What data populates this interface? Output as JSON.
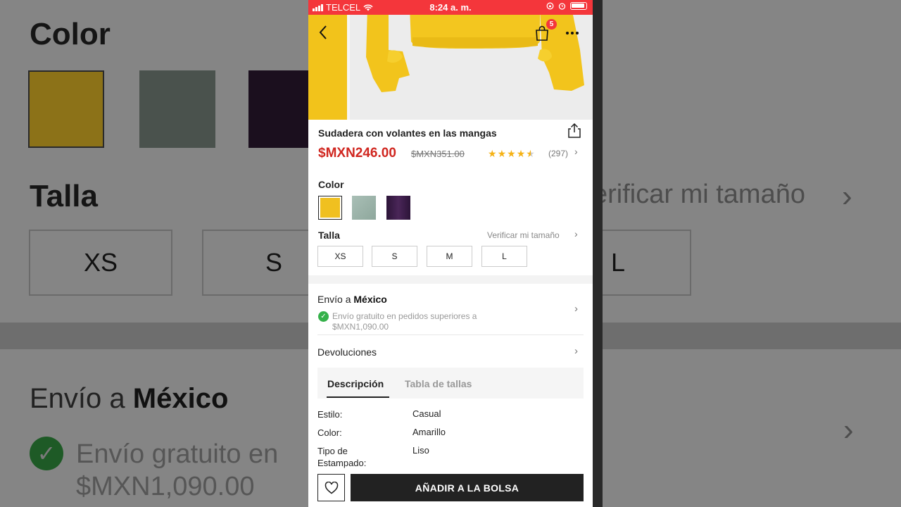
{
  "status_bar": {
    "carrier": "TELCEL",
    "time": "8:24 a. m."
  },
  "header": {
    "bag_count": "5"
  },
  "product": {
    "title": "Sudadera con volantes en las mangas",
    "price": "$MXN246.00",
    "original_price": "$MXN351.00",
    "rating": 4.5,
    "reviews": "(297)"
  },
  "color_section": {
    "label": "Color",
    "swatches": [
      {
        "name": "yellow",
        "hex": "#f0c020",
        "selected": true
      },
      {
        "name": "sage",
        "hex": "#9fb5ad",
        "selected": false
      },
      {
        "name": "purple",
        "hex": "#3a1c45",
        "selected": false
      }
    ]
  },
  "size_section": {
    "label": "Talla",
    "verify_link": "Verificar mi tamaño",
    "sizes": [
      "XS",
      "S",
      "M",
      "L"
    ]
  },
  "shipping": {
    "prefix": "Envío a",
    "country": "México",
    "free_text": "Envío gratuito en pedidos superiores a $MXN1,090.00"
  },
  "returns": {
    "label": "Devoluciones"
  },
  "tabs": {
    "description": "Descripción",
    "size_chart": "Tabla de tallas"
  },
  "specs": [
    {
      "key": "Estilo:",
      "value": "Casual"
    },
    {
      "key": "Color:",
      "value": "Amarillo"
    },
    {
      "key": "Tipo de Estampado:",
      "value": "Liso"
    }
  ],
  "actions": {
    "add_to_bag": "AÑADIR A LA BOLSA"
  },
  "background_zoom": {
    "color_label": "Color",
    "size_label": "Talla",
    "verify_link": "erificar mi tamaño",
    "sizes": [
      "XS",
      "S",
      "L"
    ],
    "ship_prefix": "Envío a",
    "ship_country": "México",
    "free_line1": "Envío gratuito en",
    "free_line2": "$MXN1,090.00"
  },
  "colors": {
    "accent_red": "#f4363b",
    "price_red": "#d0261f",
    "star": "#f5b216",
    "success": "#35b14a"
  }
}
